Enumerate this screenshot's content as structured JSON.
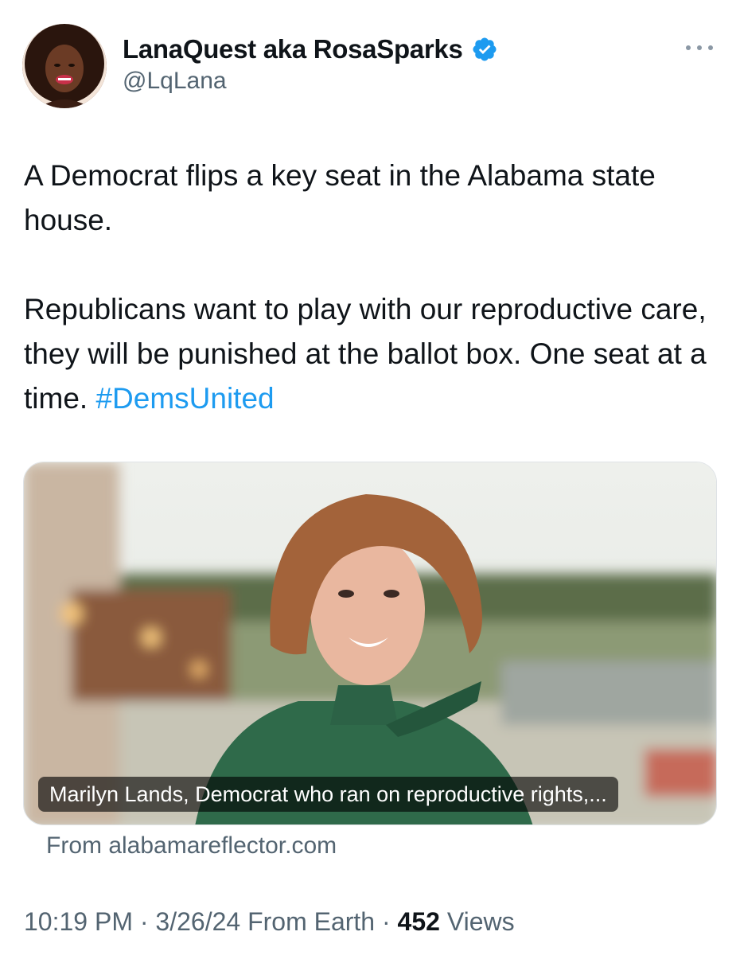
{
  "author": {
    "display_name": "LanaQuest aka RosaSparks",
    "handle": "@LqLana",
    "verified": true,
    "verified_color": "#1d9bf0",
    "avatar_icon": "profile-avatar"
  },
  "more_icon": "more-horizontal-icon",
  "tweet": {
    "paragraph_1": "A Democrat flips a key seat in the Alabama state house.",
    "paragraph_2": "Republicans want to play with our reproductive care, they will be punished at the ballot box. One seat at a time.",
    "hashtag": "#DemsUnited",
    "hashtag_color": "#1d9bf0"
  },
  "link_card": {
    "caption": "Marilyn Lands, Democrat who ran on reproductive rights,...",
    "source": "From alabamareflector.com"
  },
  "meta": {
    "time": "10:19 PM",
    "separator": "·",
    "date": "3/26/24",
    "location": "From Earth",
    "views_count": "452",
    "views_label": "Views"
  }
}
